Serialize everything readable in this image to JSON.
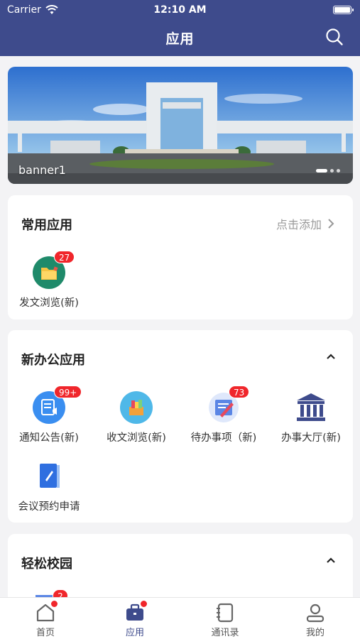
{
  "status_bar": {
    "carrier": "Carrier",
    "time": "12:10 AM"
  },
  "nav": {
    "title": "应用"
  },
  "banner": {
    "label": "banner1"
  },
  "common_apps": {
    "title": "常用应用",
    "action_label": "点击添加",
    "items": [
      {
        "label": "发文浏览(新)",
        "badge": "27"
      }
    ]
  },
  "new_office": {
    "title": "新办公应用",
    "items": [
      {
        "label": "通知公告(新)",
        "badge": "99+"
      },
      {
        "label": "收文浏览(新)",
        "badge": ""
      },
      {
        "label": "待办事项（新)",
        "badge": "73"
      },
      {
        "label": "办事大厅(新)",
        "badge": ""
      },
      {
        "label": "会议预约申请",
        "badge": ""
      }
    ]
  },
  "easy_campus": {
    "title": "轻松校园",
    "items": [
      {
        "badge": "2"
      }
    ]
  },
  "tabbar": {
    "items": [
      {
        "label": "首页"
      },
      {
        "label": "应用"
      },
      {
        "label": "通讯录"
      },
      {
        "label": "我的"
      }
    ]
  },
  "colors": {
    "nav_bg": "#3e4b8c",
    "badge": "#f0262b",
    "active_tab": "#3e4b8c"
  }
}
